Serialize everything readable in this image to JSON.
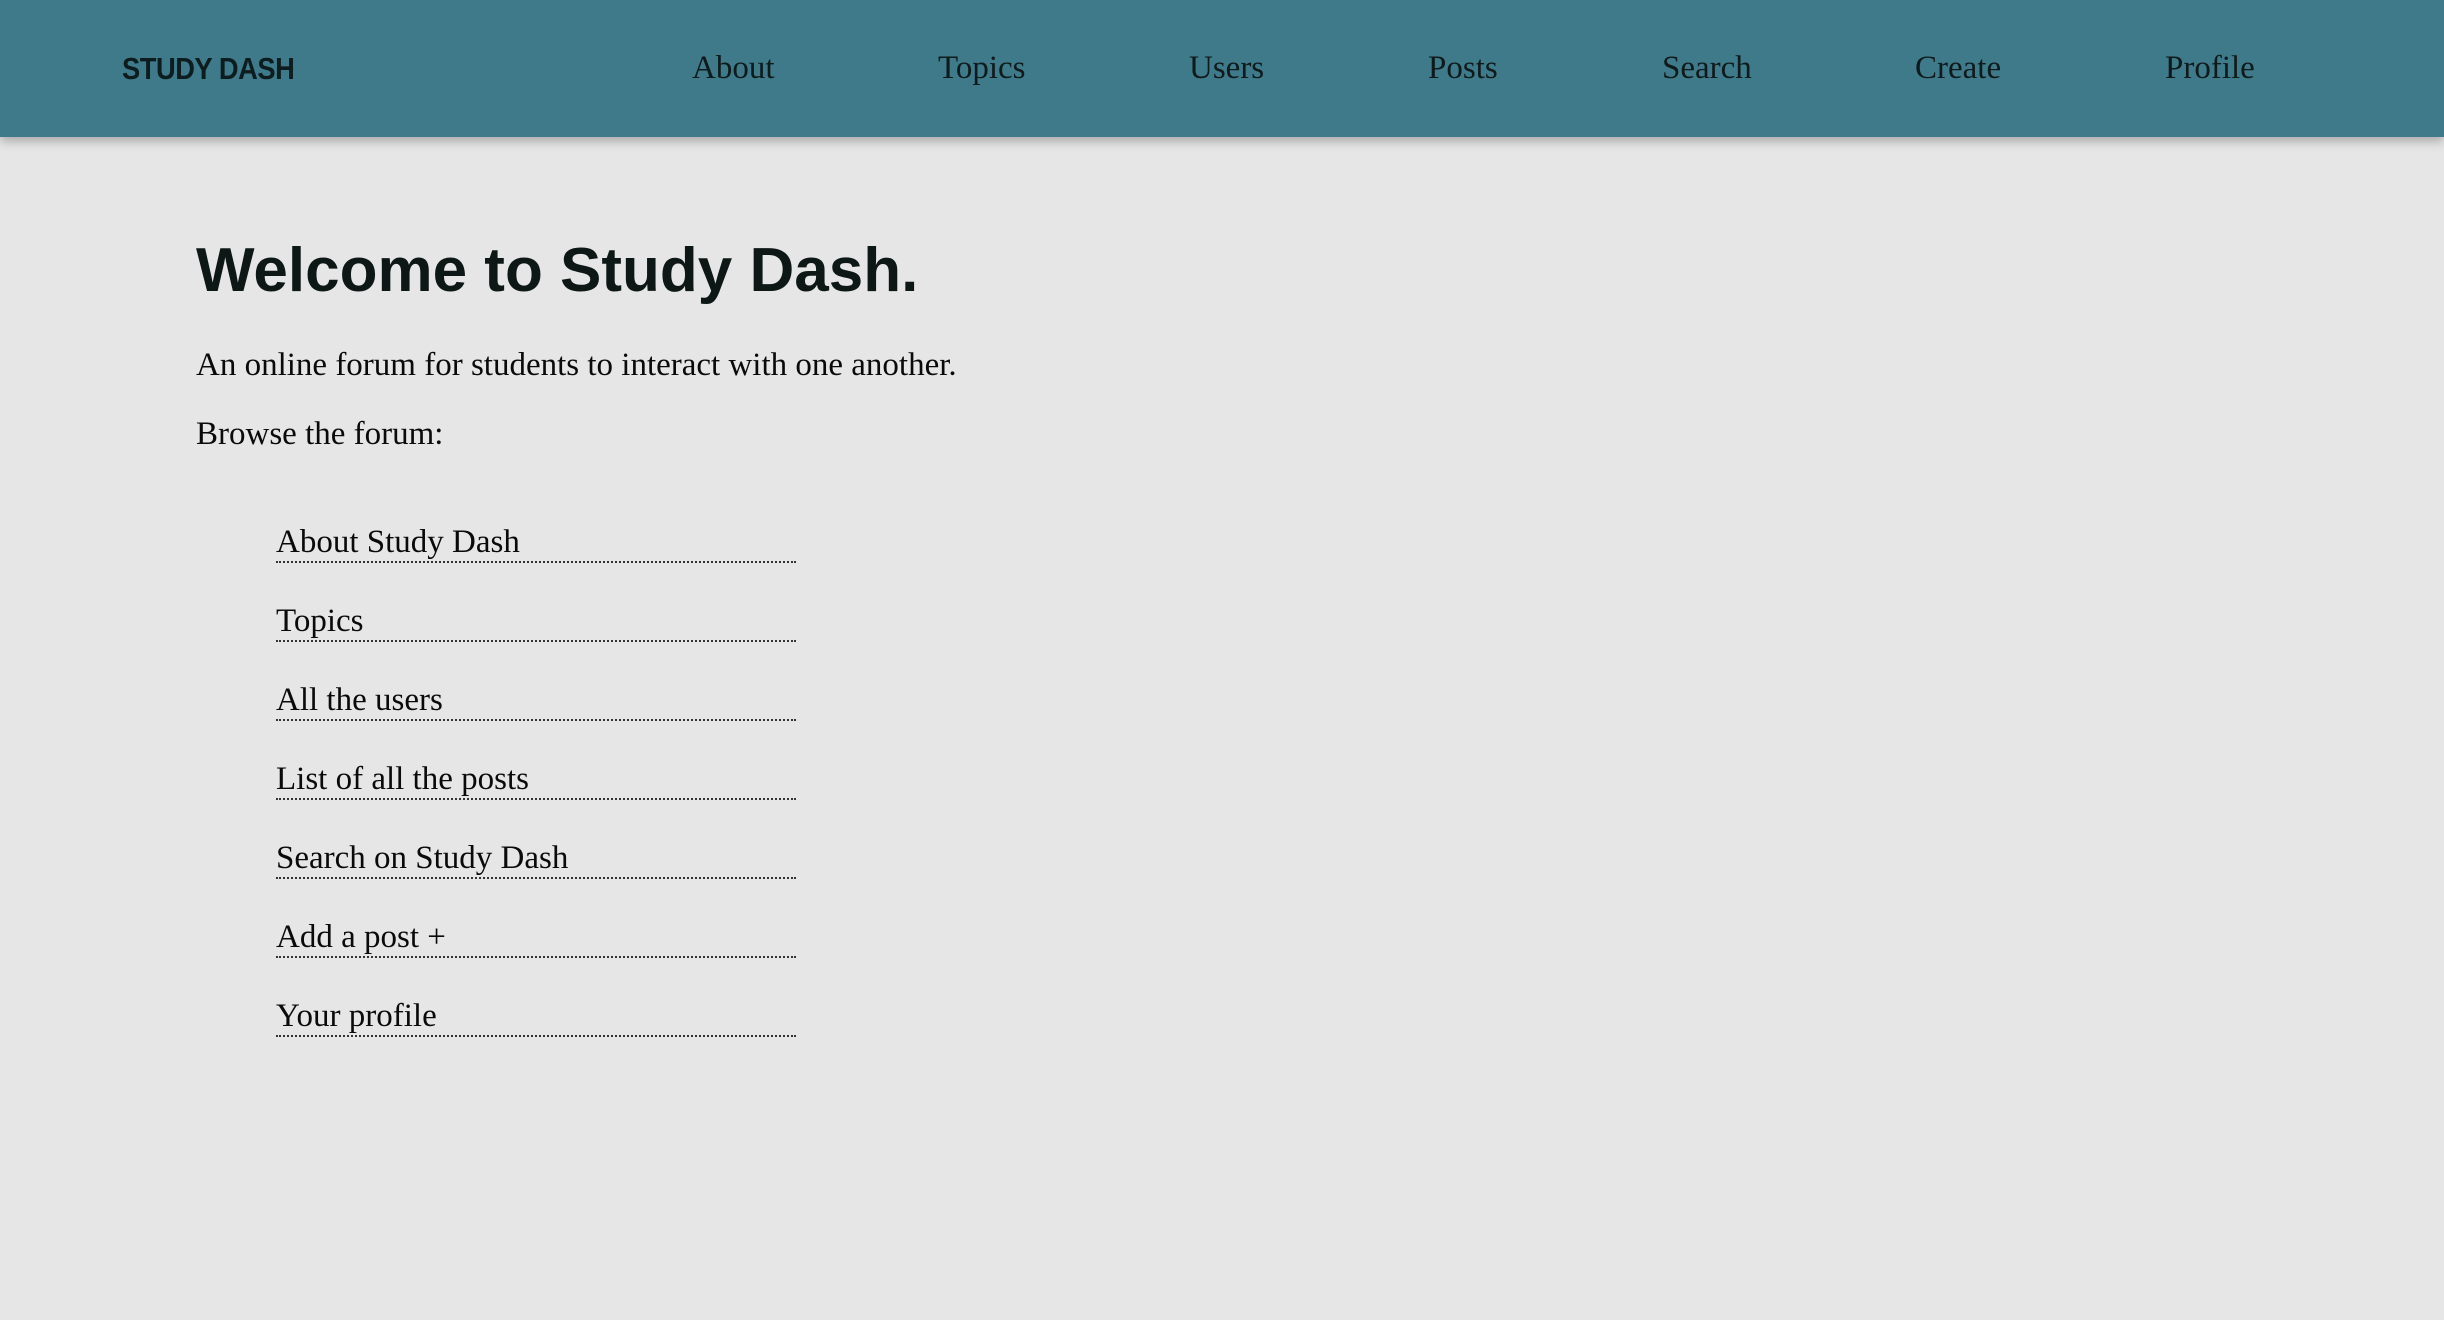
{
  "header": {
    "logo": "STUDY DASH",
    "nav": [
      {
        "label": "About"
      },
      {
        "label": "Topics"
      },
      {
        "label": "Users"
      },
      {
        "label": "Posts"
      },
      {
        "label": "Search"
      },
      {
        "label": "Create"
      },
      {
        "label": "Profile"
      }
    ]
  },
  "main": {
    "title": "Welcome to Study Dash.",
    "description": "An online forum for students to interact with one another.",
    "browse_label": "Browse the forum:",
    "links": [
      {
        "label": "About Study Dash"
      },
      {
        "label": "Topics"
      },
      {
        "label": "All the users"
      },
      {
        "label": "List of all the posts"
      },
      {
        "label": "Search on Study Dash"
      },
      {
        "label": "Add a post +"
      },
      {
        "label": "Your profile"
      }
    ]
  },
  "colors": {
    "header_bg": "#3e7a89",
    "page_bg": "#e6e6e6",
    "text": "#0e1412"
  }
}
